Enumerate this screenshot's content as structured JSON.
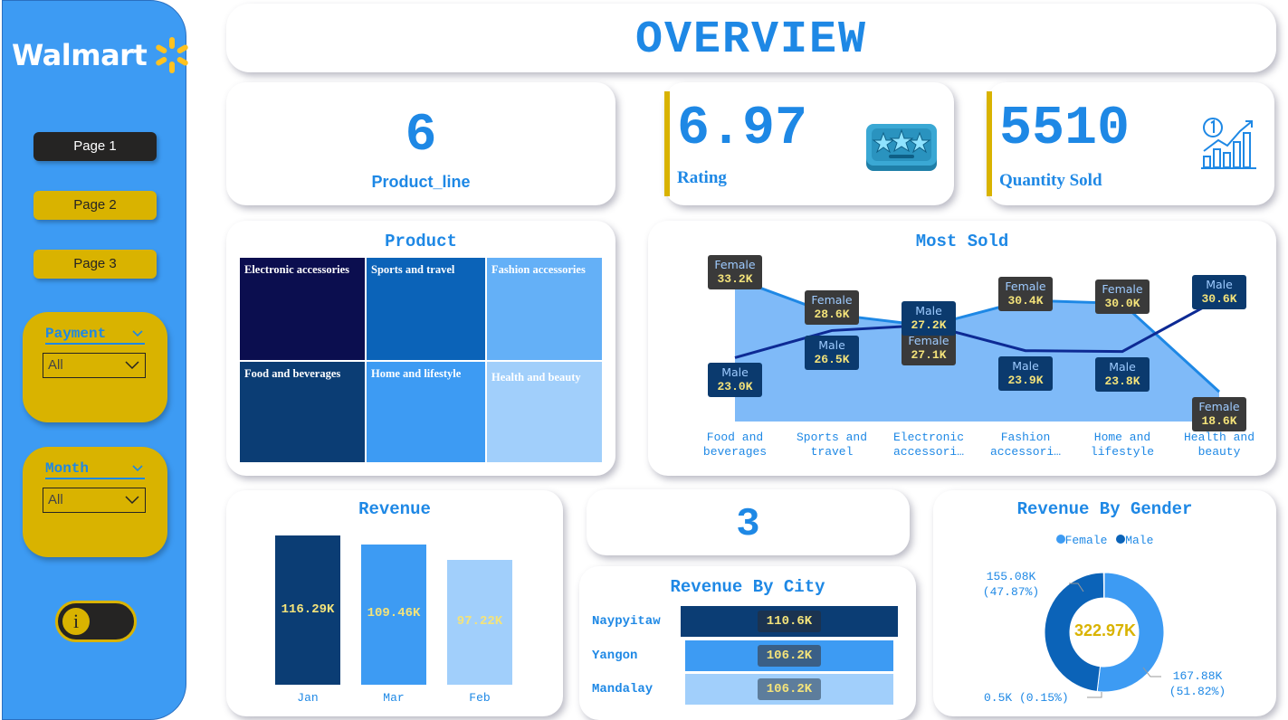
{
  "brand": {
    "name": "Walmart",
    "spark_color": "#ffc220"
  },
  "nav": {
    "pages": [
      {
        "label": "Page 1",
        "active": true
      },
      {
        "label": "Page 2",
        "active": false
      },
      {
        "label": "Page 3",
        "active": false
      }
    ]
  },
  "filters": {
    "payment": {
      "label": "Payment",
      "value": "All"
    },
    "month": {
      "label": "Month",
      "value": "All"
    }
  },
  "info_toggle": {
    "icon": "info-icon",
    "symbol": "i"
  },
  "header": {
    "title": "OVERVIEW"
  },
  "kpis": {
    "product_line": {
      "value": "6",
      "label": "Product_line"
    },
    "rating": {
      "value": "6.97",
      "label": "Rating",
      "icon": "stars-icon"
    },
    "quantity": {
      "value": "5510",
      "label": "Quantity Sold",
      "icon": "growth-chart-icon"
    }
  },
  "product_treemap": {
    "title": "Product",
    "cells": [
      {
        "label": "Electronic accessories",
        "color": "#0b0e4f"
      },
      {
        "label": "Sports and travel",
        "color": "#0b63b8"
      },
      {
        "label": "Fashion accessories",
        "color": "#64b0f7"
      },
      {
        "label": "Food and beverages",
        "color": "#0b3d74"
      },
      {
        "label": "Home and lifestyle",
        "color": "#3d9bf3"
      },
      {
        "label": "Health and beauty",
        "color": "#a1cffb"
      }
    ]
  },
  "city_count": {
    "value": "3"
  },
  "chart_data": [
    {
      "type": "line",
      "title": "Most Sold",
      "categories": [
        "Food and beverages",
        "Sports and travel",
        "Electronic accessori…",
        "Fashion accessori…",
        "Home and lifestyle",
        "Health and beauty"
      ],
      "series": [
        {
          "name": "Female",
          "values": [
            33.2,
            28.6,
            27.1,
            30.4,
            30.0,
            18.6
          ],
          "labels": [
            "33.2K",
            "28.6K",
            "27.1K",
            "30.4K",
            "30.0K",
            "18.6K"
          ],
          "color": "#1e88e5",
          "area": true
        },
        {
          "name": "Male",
          "values": [
            23.0,
            26.5,
            27.2,
            23.9,
            23.8,
            30.6
          ],
          "labels": [
            "23.0K",
            "26.5K",
            "27.2K",
            "23.9K",
            "23.8K",
            "30.6K"
          ],
          "color": "#0d2a94"
        }
      ],
      "ylim": [
        15,
        36
      ]
    },
    {
      "type": "bar",
      "title": "Revenue",
      "categories": [
        "Jan",
        "Mar",
        "Feb"
      ],
      "values": [
        116.29,
        109.46,
        97.22
      ],
      "labels": [
        "116.29K",
        "109.46K",
        "97.22K"
      ],
      "colors": [
        "#0b3d74",
        "#3d9bf3",
        "#a1cffb"
      ],
      "ylim": [
        0,
        120
      ]
    },
    {
      "type": "bar",
      "orientation": "horizontal",
      "title": "Revenue By City",
      "categories": [
        "Naypyitaw",
        "Yangon",
        "Mandalay"
      ],
      "values": [
        110.6,
        106.2,
        106.2
      ],
      "labels": [
        "110.6K",
        "106.2K",
        "106.2K"
      ],
      "colors": [
        "#0b3d74",
        "#3d9bf3",
        "#a1cffb"
      ]
    },
    {
      "type": "pie",
      "title": "Revenue By Gender",
      "center_label": "322.97K",
      "legend": [
        "Female",
        "Male"
      ],
      "slices": [
        {
          "name": "Female",
          "value": 167.88,
          "percent": 51.82,
          "label": "167.88K\n(51.82%)",
          "color": "#3d9bf3"
        },
        {
          "name": "Male",
          "value": 155.08,
          "percent": 47.87,
          "label": "155.08K\n(47.87%)",
          "color": "#0b63b8"
        },
        {
          "name": "",
          "value": 0.5,
          "percent": 0.15,
          "label": "0.5K (0.15%)",
          "color": "#0b3d74"
        }
      ]
    }
  ]
}
